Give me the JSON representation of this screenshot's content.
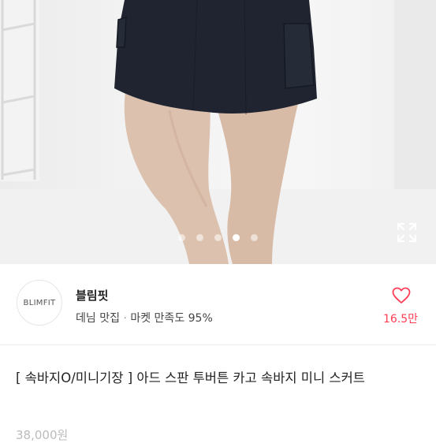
{
  "carousel": {
    "slide_count": 5,
    "active_index": 3,
    "expand_icon": "expand-arrows-icon"
  },
  "shop": {
    "logo_text": "BLIMFIT",
    "name": "블림핏",
    "tag": "데님 맛집",
    "separator": "·",
    "satisfaction": "마켓 만족도 95%",
    "heart_icon": "heart-outline-icon",
    "likes": "16.5만"
  },
  "product": {
    "title": "[ 속바지O/미니기장 ] 아드 스판 투버튼 카고 속바지 미니 스커트",
    "price": "38,000원"
  },
  "colors": {
    "accent": "#ff3d55",
    "skirt": "#1f2430"
  }
}
